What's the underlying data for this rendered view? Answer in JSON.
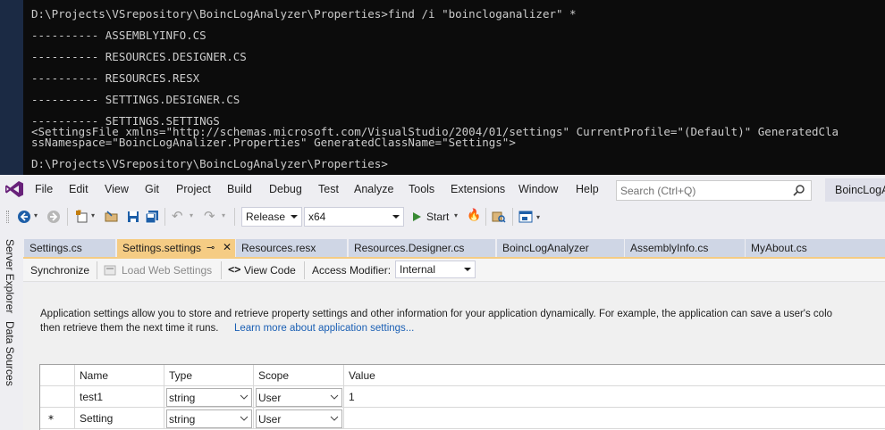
{
  "console": {
    "lines": [
      "D:\\Projects\\VSrepository\\BoincLogAnalyzer\\Properties>find /i \"boincloganalizer\" *",
      "---------- ASSEMBLYINFO.CS",
      "---------- RESOURCES.DESIGNER.CS",
      "---------- RESOURCES.RESX",
      "---------- SETTINGS.DESIGNER.CS",
      "---------- SETTINGS.SETTINGS",
      "<SettingsFile xmlns=\"http://schemas.microsoft.com/VisualStudio/2004/01/settings\" CurrentProfile=\"(Default)\" GeneratedCla",
      "ssNamespace=\"BoincLogAnalizer.Properties\" GeneratedClassName=\"Settings\">",
      "D:\\Projects\\VSrepository\\BoincLogAnalyzer\\Properties>"
    ]
  },
  "menu": {
    "items": [
      "File",
      "Edit",
      "View",
      "Git",
      "Project",
      "Build",
      "Debug",
      "Test",
      "Analyze",
      "Tools",
      "Extensions",
      "Window",
      "Help"
    ],
    "search_placeholder": "Search (Ctrl+Q)",
    "project_title": "BoincLogA"
  },
  "toolbar": {
    "configuration": "Release",
    "platform": "x64",
    "start_label": "Start"
  },
  "side_panel": {
    "tabs": [
      "Server Explorer",
      "Data Sources"
    ]
  },
  "tabs": [
    {
      "label": "Settings.cs",
      "active": false
    },
    {
      "label": "Settings.settings",
      "active": true
    },
    {
      "label": "Resources.resx",
      "active": false
    },
    {
      "label": "Resources.Designer.cs",
      "active": false
    },
    {
      "label": "BoincLogAnalyzer",
      "active": false
    },
    {
      "label": "AssemblyInfo.cs",
      "active": false
    },
    {
      "label": "MyAbout.cs",
      "active": false
    }
  ],
  "settings_toolbar": {
    "synchronize": "Synchronize",
    "load_web_settings": "Load Web Settings",
    "view_code": "View Code",
    "access_modifier_label": "Access Modifier:",
    "access_modifier_value": "Internal"
  },
  "description": {
    "line1": "Application settings allow you to store and retrieve property settings and other information for your application dynamically. For example, the application can save a user's colo",
    "line2": "then retrieve them the next time it runs.",
    "link": "Learn more about application settings..."
  },
  "grid": {
    "columns": [
      "Name",
      "Type",
      "Scope",
      "Value"
    ],
    "rows": [
      {
        "marker": "",
        "name": "test1",
        "type": "string",
        "scope": "User",
        "value": "1"
      },
      {
        "marker": "*",
        "name": "Setting",
        "type": "string",
        "scope": "User",
        "value": ""
      }
    ]
  },
  "colors": {
    "console_bg": "#0c0c0c",
    "vs_purple": "#68217a",
    "active_tab": "#f5cc84",
    "link": "#1a5fb4"
  }
}
